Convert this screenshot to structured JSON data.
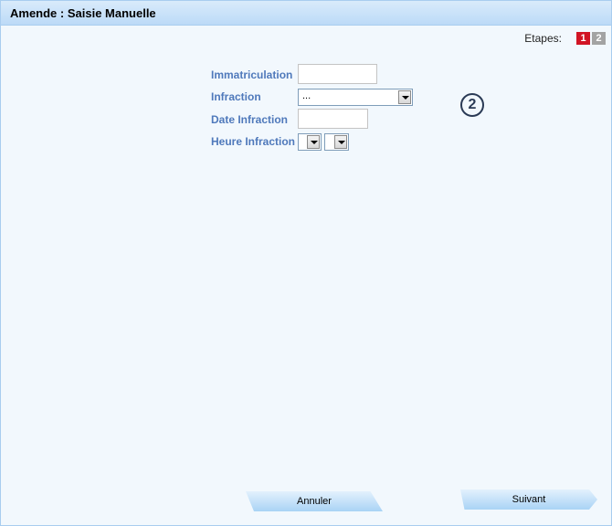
{
  "window": {
    "title": "Amende : Saisie Manuelle"
  },
  "steps": {
    "label": "Etapes:",
    "items": [
      {
        "label": "1",
        "active": true
      },
      {
        "label": "2",
        "active": false
      }
    ]
  },
  "form": {
    "immatriculation": {
      "label": "Immatriculation",
      "value": ""
    },
    "infraction": {
      "label": "Infraction",
      "selected": "..."
    },
    "date_infraction": {
      "label": "Date Infraction",
      "value": ""
    },
    "heure_infraction": {
      "label": "Heure Infraction",
      "hour": "",
      "minute": ""
    }
  },
  "annotation": {
    "marker": "2"
  },
  "buttons": {
    "cancel": "Annuler",
    "next": "Suivant"
  },
  "colors": {
    "accent_label": "#4f79bb",
    "step_active": "#d11424",
    "step_inactive": "#a3a3a3",
    "titlebar": "#bcdaf7"
  }
}
